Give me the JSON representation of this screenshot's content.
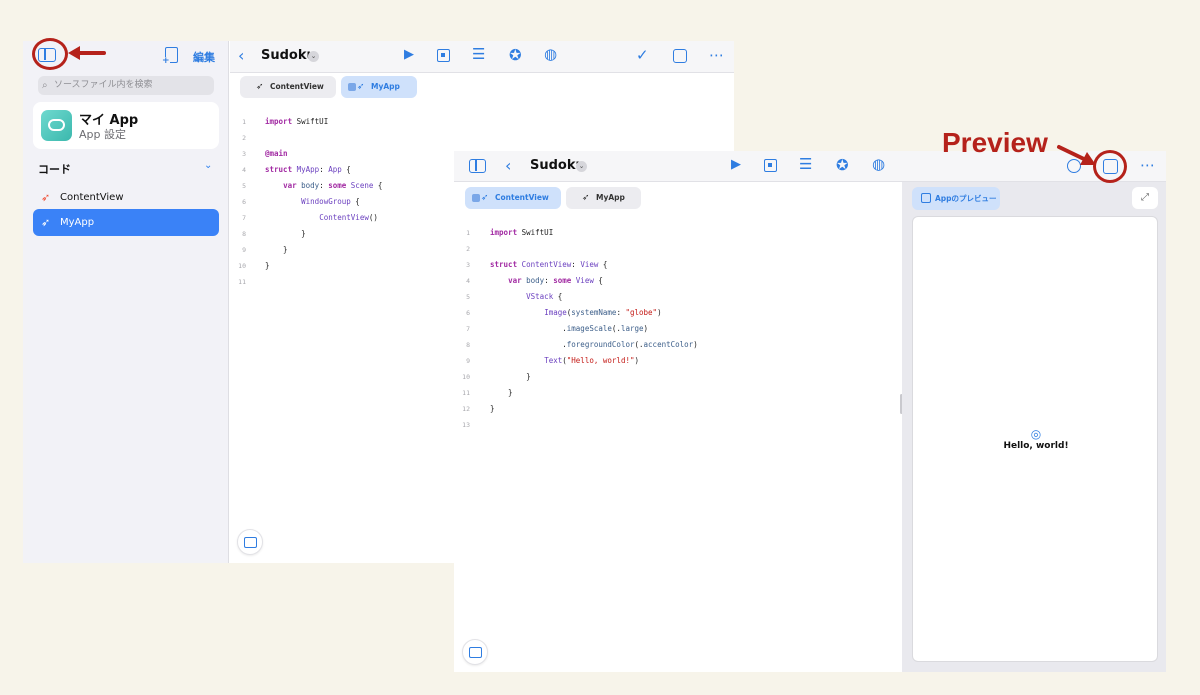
{
  "window1": {
    "sidebar": {
      "edit_label": "編集",
      "search_placeholder": "ソースファイル内を検索",
      "app_title": "マイ App",
      "app_subtitle": "App 設定",
      "section_label": "コード",
      "files": [
        {
          "label": "ContentView",
          "selected": false
        },
        {
          "label": "MyApp",
          "selected": true
        }
      ]
    },
    "editor": {
      "title": "Sudoku",
      "tabs": [
        "ContentView",
        "MyApp"
      ],
      "line_numbers": [
        "1",
        "2",
        "3",
        "4",
        "5",
        "6",
        "7",
        "8",
        "9",
        "10",
        "11"
      ]
    }
  },
  "window2": {
    "editor": {
      "title": "Sudoku",
      "tabs": [
        "ContentView",
        "MyApp"
      ],
      "line_numbers": [
        "1",
        "2",
        "3",
        "4",
        "5",
        "6",
        "7",
        "8",
        "9",
        "10",
        "11",
        "12",
        "13"
      ]
    },
    "preview": {
      "chip_label": "Appのプレビュー",
      "output_text": "Hello, world!"
    }
  },
  "annotation": {
    "label": "Preview",
    "color": "#b5221b"
  },
  "colors": {
    "accent": "#2f7de1",
    "selection": "#3a82f7",
    "background": "#f7f4ea"
  }
}
